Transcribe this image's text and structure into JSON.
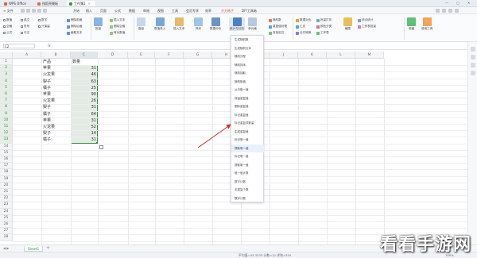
{
  "titlebar": {
    "tabs": [
      {
        "label": "WPS Office",
        "color": "#e05b4f"
      },
      {
        "label": "找稻壳模板",
        "color": "#e26b43"
      },
      {
        "label": "工作簿1",
        "color": "#3d9a4c"
      }
    ],
    "window_controls": [
      "—",
      "▢",
      "✕"
    ]
  },
  "menu": {
    "file": "≡ 文件",
    "items": [
      "开始",
      "插入",
      "页面",
      "公式",
      "数据",
      "审阅",
      "视图",
      "工具",
      "会员专享",
      "效率",
      "方方格子",
      "DIY工具箱"
    ],
    "active_index": 10
  },
  "ribbon": {
    "checks": [
      "数值",
      "空格",
      "公式",
      "英文",
      "符号",
      "中文",
      "数字",
      "只保留"
    ],
    "groups": [
      {
        "label": "文本处理",
        "items": [
          "删除前缀",
          "删除后缀",
          "截取文本"
        ]
      },
      {
        "label": "高级分类",
        "items": [
          "插入文本",
          "删除空格",
          "转为数值"
        ]
      }
    ],
    "big_buttons": [
      "批量",
      "高级",
      "数值录入",
      "插入文本",
      "排序",
      "数据分析",
      "统计与分析",
      "单元格",
      "随机数",
      "重复值处理",
      "查找定位",
      "数据对比",
      "汇总",
      "合并转换",
      "工作表",
      "截图",
      "收藏",
      "使用工具"
    ],
    "right_items": [
      "批量打印",
      "颜色分类",
      "综合统计",
      "工作表批量"
    ]
  },
  "formula_bar": {
    "name_box": "C2",
    "fx": "fx"
  },
  "columns": [
    "A",
    "B",
    "C",
    "D",
    "E",
    "F",
    "G",
    "H",
    "I",
    "J",
    "K",
    "L",
    "M"
  ],
  "rows": [
    "1",
    "2",
    "3",
    "4",
    "5",
    "6",
    "7",
    "8",
    "9",
    "10",
    "11",
    "12",
    "13",
    "14",
    "15",
    "16",
    "17",
    "18",
    "19",
    "20",
    "21",
    "22",
    "23",
    "24",
    "25",
    "26",
    "27",
    "28"
  ],
  "table": {
    "header": [
      "产品",
      "数量"
    ],
    "data": [
      [
        "苹果",
        "31"
      ],
      [
        "火龙果",
        "46"
      ],
      [
        "梨子",
        "63"
      ],
      [
        "橘子",
        "25"
      ],
      [
        "苹果",
        "90"
      ],
      [
        "火龙果",
        "26"
      ],
      [
        "梨子",
        "31"
      ],
      [
        "橘子",
        "64"
      ],
      [
        "苹果",
        "31"
      ],
      [
        "火龙果",
        "52"
      ],
      [
        "梨子",
        "14"
      ],
      [
        "橘子",
        "31"
      ]
    ]
  },
  "dropdown": {
    "items": [
      "生成随机数",
      "生成随机文本",
      "随机分配",
      "随机排序",
      "随机抽取",
      "随机取值",
      "从中取一值",
      "保留重复值",
      "删除重复值",
      "标记重复值",
      "标记重复项数量",
      "生成重复值",
      "标记唯一值",
      "提取唯一值",
      "标记唯一值",
      "提取唯一值",
      "唯一值计数",
      "数字计数",
      "无重复个数",
      "数字计数"
    ],
    "highlight_index": 13
  },
  "sheets": [
    "Sheet1"
  ],
  "status": {
    "left": "平均值=43.3333  计数=12  求和=520",
    "zoom": "100%"
  },
  "watermark": "看看手游网",
  "colors": {
    "accent": "#3d8c4a",
    "selection": "#e4ebe5",
    "arrow": "#c0392b"
  }
}
